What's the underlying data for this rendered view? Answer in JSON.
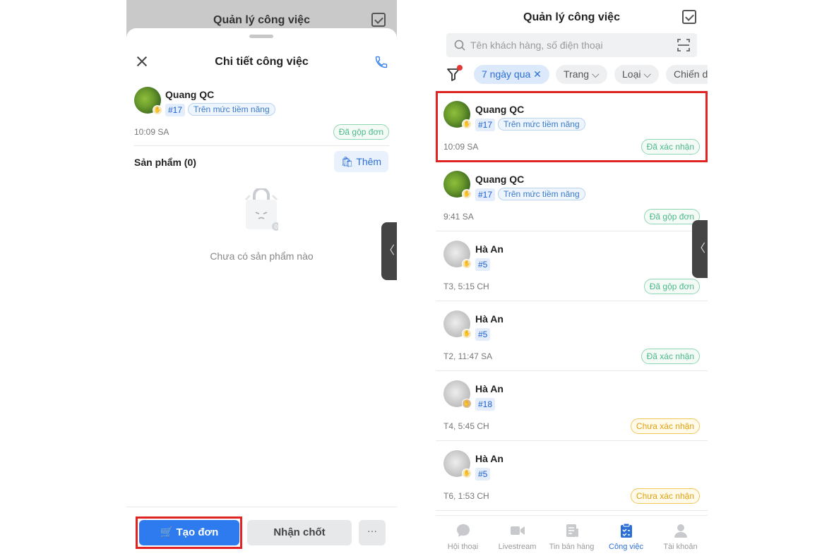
{
  "left": {
    "header_title": "Quản lý công việc",
    "sheet_title": "Chi tiết công việc",
    "customer": {
      "name": "Quang QC",
      "id_tag": "#17",
      "status_tag": "Trên mức tiềm năng",
      "time": "10:09 SA",
      "state": "Đã gộp đơn"
    },
    "products_label": "Sản phẩm (0)",
    "add_label": "Thêm",
    "empty_text": "Chưa có sản phẩm nào",
    "create_order_label": "Tạo đơn",
    "accept_label": "Nhận chốt",
    "more_label": "···",
    "side_tab_glyph": "〈"
  },
  "right": {
    "title": "Quản lý công việc",
    "search_placeholder": "Tên khách hàng, số điện thoại",
    "chips": [
      {
        "label": "7 ngày qua ✕",
        "active": true
      },
      {
        "label": "Trang ⌵",
        "active": false
      },
      {
        "label": "Loại ⌵",
        "active": false
      },
      {
        "label": "Chiến d",
        "active": false
      }
    ],
    "cards": [
      {
        "name": "Quang QC",
        "id": "#17",
        "status": "Trên mức tiềm năng",
        "time": "10:09 SA",
        "state": "Đã xác nhận",
        "state_color": "green"
      },
      {
        "name": "Quang QC",
        "id": "#17",
        "status": "Trên mức tiềm năng",
        "time": "9:41 SA",
        "state": "Đã gộp đơn",
        "state_color": "green"
      },
      {
        "name": "Hà An",
        "id": "#5",
        "status": "",
        "time": "T3, 5:15 CH",
        "state": "Đã gộp đơn",
        "state_color": "green"
      },
      {
        "name": "Hà An",
        "id": "#5",
        "status": "",
        "time": "T2, 11:47 SA",
        "state": "Đã xác nhận",
        "state_color": "green"
      },
      {
        "name": "Hà An",
        "id": "#18",
        "status": "",
        "time": "T4, 5:45 CH",
        "state": "Chưa xác nhận",
        "state_color": "orange"
      },
      {
        "name": "Hà An",
        "id": "#5",
        "status": "",
        "time": "T6, 1:53 CH",
        "state": "Chưa xác nhận",
        "state_color": "orange"
      }
    ],
    "side_tab_glyph": "〈",
    "tabs": [
      {
        "label": "Hội thoại",
        "icon": "chat-icon",
        "active": false
      },
      {
        "label": "Livestream",
        "icon": "video-camera-icon",
        "active": false
      },
      {
        "label": "Tin bán hàng",
        "icon": "news-icon",
        "active": false
      },
      {
        "label": "Công việc",
        "icon": "clipboard-task-icon",
        "active": true
      },
      {
        "label": "Tài khoản",
        "icon": "user-icon",
        "active": false
      }
    ]
  },
  "colors": {
    "primary": "#2e7bf0",
    "highlight": "#e02424",
    "confirmed_green": "#4cb98a",
    "pending_orange": "#e0a20f"
  }
}
